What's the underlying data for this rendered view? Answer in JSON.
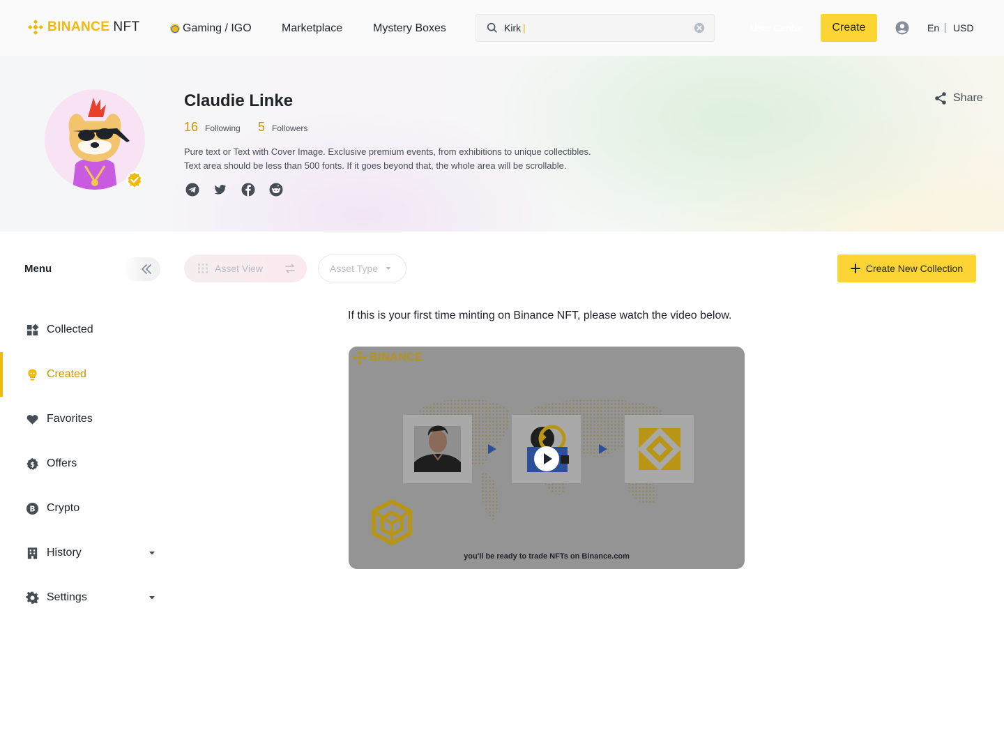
{
  "header": {
    "logo_brand": "BINANCE",
    "logo_suffix": "NFT",
    "nav": {
      "gaming": "Gaming / IGO",
      "marketplace": "Marketplace",
      "mystery": "Mystery Boxes"
    },
    "search": {
      "value": "Kirk"
    },
    "user_center": "User Center",
    "create_label": "Create",
    "language": "En",
    "currency": "USD"
  },
  "profile": {
    "name": "Claudie Linke",
    "following_count": "16",
    "following_label": "Following",
    "followers_count": "5",
    "followers_label": "Followers",
    "bio_line1": "Pure text or Text with Cover Image. Exclusive premium events, from exhibitions to unique collectibles.",
    "bio_line2": "Text area should be less than 500 fonts. If it goes beyond that, the whole area will be scrollable.",
    "socials": [
      "telegram-icon",
      "twitter-icon",
      "facebook-icon",
      "reddit-icon"
    ],
    "share_label": "Share"
  },
  "sidebar": {
    "title": "Menu",
    "items": [
      {
        "label": "Collected",
        "icon": "grid-icon"
      },
      {
        "label": "Created",
        "icon": "bulb-icon",
        "active": true
      },
      {
        "label": "Favorites",
        "icon": "heart-icon"
      },
      {
        "label": "Offers",
        "icon": "dollar-icon"
      },
      {
        "label": "Crypto",
        "icon": "bitcoin-icon"
      },
      {
        "label": "History",
        "icon": "building-icon",
        "expandable": true
      },
      {
        "label": "Settings",
        "icon": "gear-icon",
        "expandable": true
      }
    ]
  },
  "toolbar": {
    "asset_view": "Asset View",
    "asset_type": "Asset Type",
    "create_collection": "Create New Collection"
  },
  "main": {
    "intro": "If this is your first time minting on Binance NFT, please watch the video below.",
    "video_logo": "BINANCE",
    "video_caption": "you'll be ready to trade NFTs on Binance.com"
  },
  "colors": {
    "brand_yellow": "#fcd535",
    "brand_gold": "#f0b90b",
    "active_text": "#c99400",
    "text_primary": "#1e2329",
    "text_secondary": "#474d57"
  }
}
